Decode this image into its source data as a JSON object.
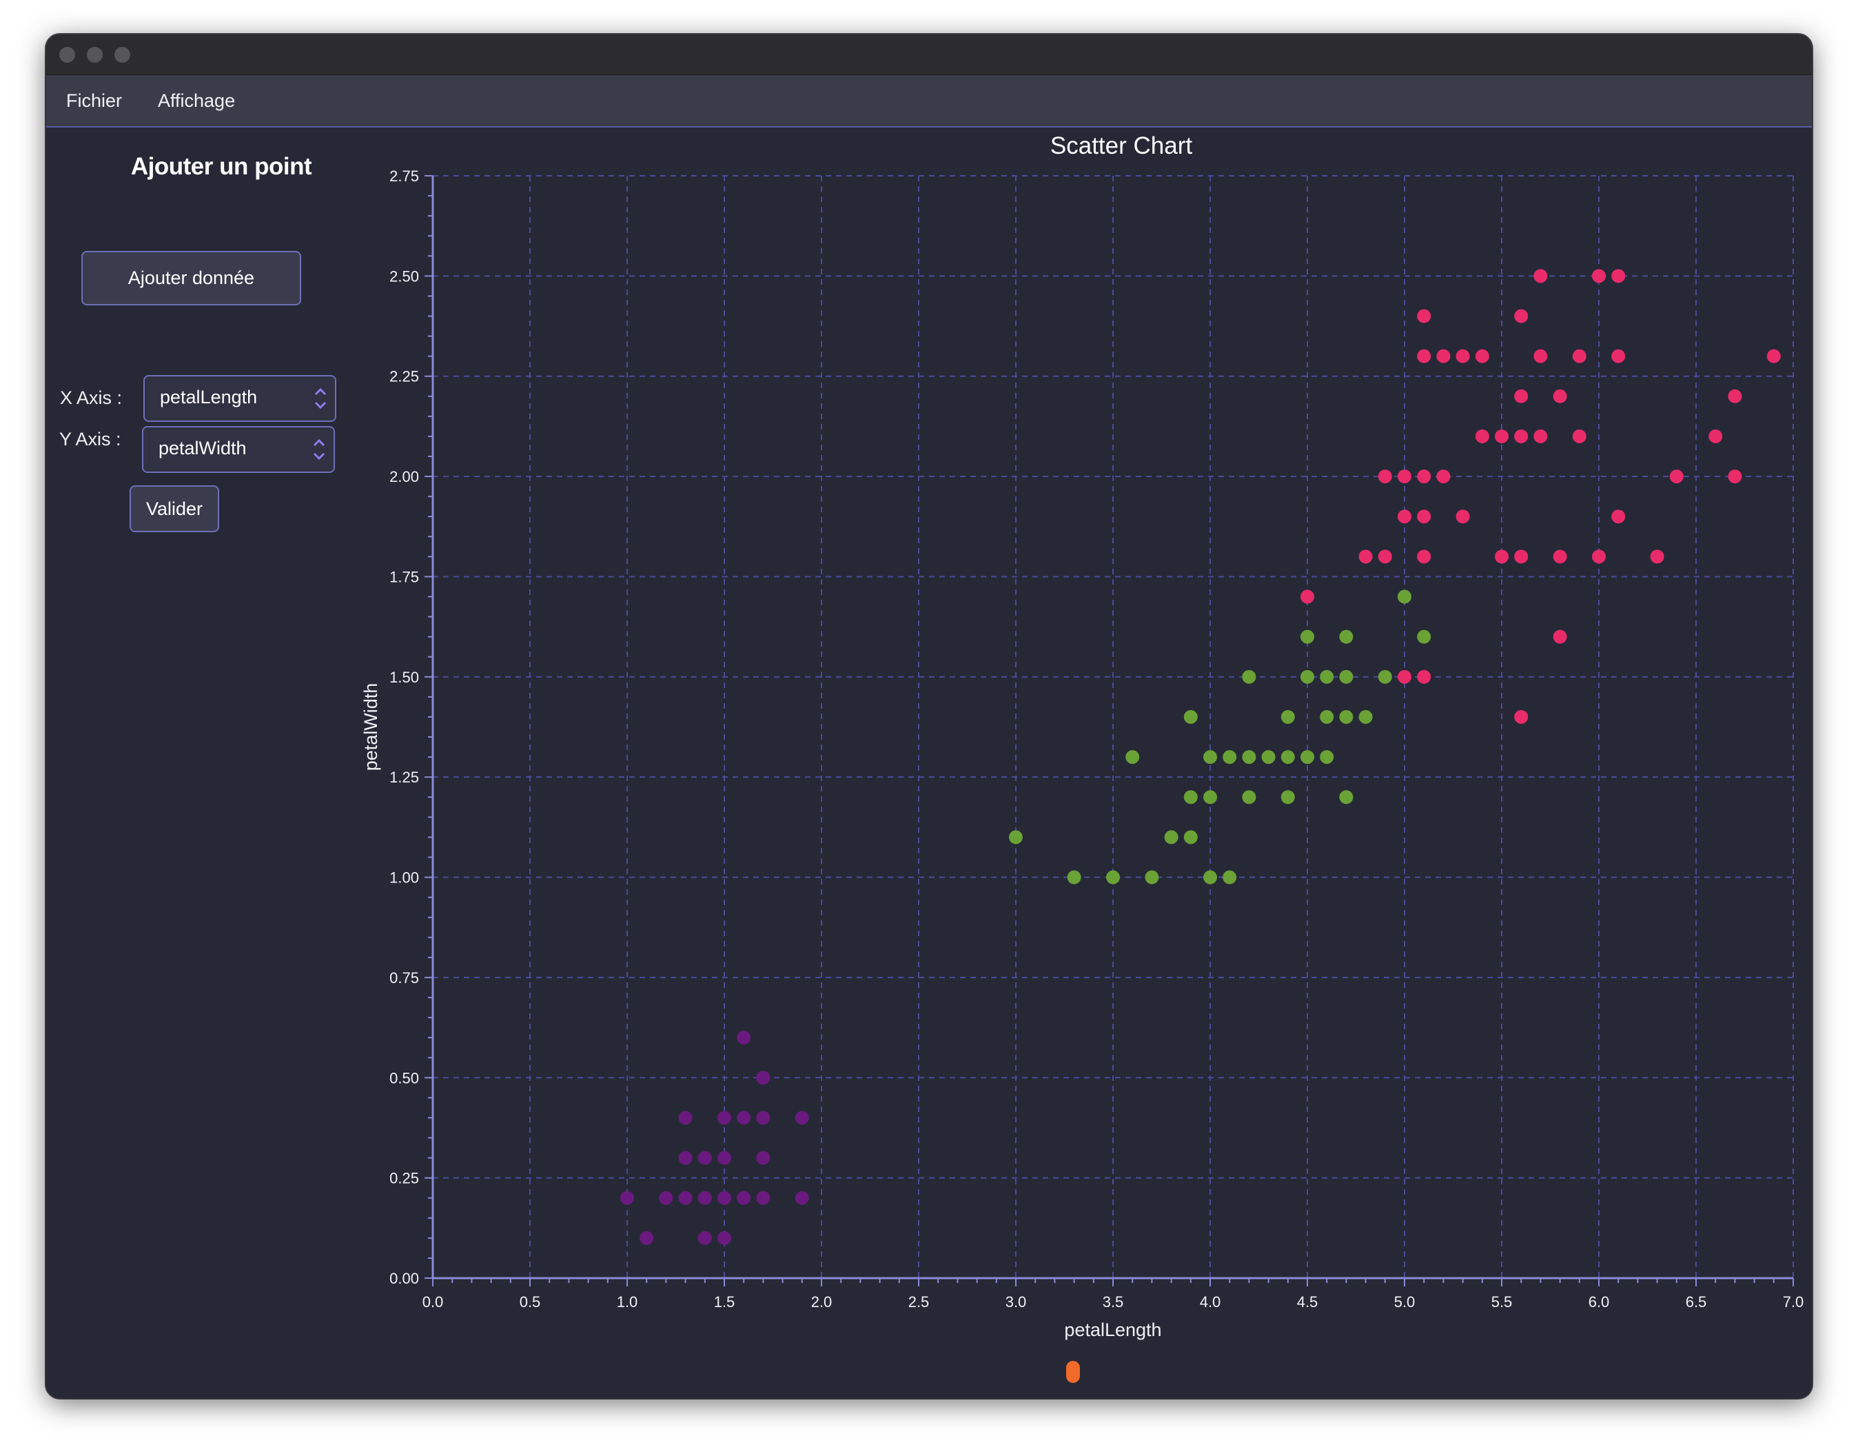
{
  "window": {
    "menu": [
      "Fichier",
      "Affichage"
    ]
  },
  "sidebar": {
    "title": "Ajouter un point",
    "add_button_label": "Ajouter donnée",
    "x_axis_label": "X Axis :",
    "y_axis_label": "Y Axis :",
    "x_axis_value": "petalLength",
    "y_axis_value": "petalWidth",
    "validate_label": "Valider"
  },
  "colors": {
    "setosa": "#6a1a7e",
    "versicolor": "#6aa236",
    "virginica": "#ea2b6a",
    "grid": "#4a4b9a",
    "axis": "#8a8ad8",
    "text": "#f1f1f5"
  },
  "chart_data": {
    "type": "scatter",
    "title": "Scatter Chart",
    "xlabel": "petalLength",
    "ylabel": "petalWidth",
    "xlim": [
      0,
      7
    ],
    "ylim": [
      0,
      2.75
    ],
    "xticks": [
      "0.0",
      "0.5",
      "1.0",
      "1.5",
      "2.0",
      "2.5",
      "3.0",
      "3.5",
      "4.0",
      "4.5",
      "5.0",
      "5.5",
      "6.0",
      "6.5",
      "7.0"
    ],
    "yticks": [
      "0.00",
      "0.25",
      "0.50",
      "0.75",
      "1.00",
      "1.25",
      "1.50",
      "1.75",
      "2.00",
      "2.25",
      "2.50",
      "2.75"
    ],
    "grid": true,
    "series": [
      {
        "color": "#6a1a7e",
        "points": [
          [
            1.0,
            0.2
          ],
          [
            1.1,
            0.1
          ],
          [
            1.2,
            0.2
          ],
          [
            1.3,
            0.2
          ],
          [
            1.3,
            0.3
          ],
          [
            1.3,
            0.4
          ],
          [
            1.4,
            0.1
          ],
          [
            1.4,
            0.2
          ],
          [
            1.4,
            0.3
          ],
          [
            1.5,
            0.1
          ],
          [
            1.5,
            0.2
          ],
          [
            1.5,
            0.3
          ],
          [
            1.5,
            0.4
          ],
          [
            1.6,
            0.2
          ],
          [
            1.6,
            0.4
          ],
          [
            1.6,
            0.6
          ],
          [
            1.7,
            0.2
          ],
          [
            1.7,
            0.3
          ],
          [
            1.7,
            0.4
          ],
          [
            1.7,
            0.5
          ],
          [
            1.9,
            0.2
          ],
          [
            1.9,
            0.4
          ]
        ]
      },
      {
        "color": "#6aa236",
        "points": [
          [
            3.0,
            1.1
          ],
          [
            3.3,
            1.0
          ],
          [
            3.5,
            1.0
          ],
          [
            3.6,
            1.3
          ],
          [
            3.7,
            1.0
          ],
          [
            3.8,
            1.1
          ],
          [
            3.9,
            1.1
          ],
          [
            3.9,
            1.2
          ],
          [
            3.9,
            1.4
          ],
          [
            4.0,
            1.0
          ],
          [
            4.0,
            1.2
          ],
          [
            4.0,
            1.3
          ],
          [
            4.1,
            1.0
          ],
          [
            4.1,
            1.3
          ],
          [
            4.2,
            1.2
          ],
          [
            4.2,
            1.3
          ],
          [
            4.2,
            1.5
          ],
          [
            4.3,
            1.3
          ],
          [
            4.4,
            1.2
          ],
          [
            4.4,
            1.3
          ],
          [
            4.4,
            1.4
          ],
          [
            4.5,
            1.3
          ],
          [
            4.5,
            1.5
          ],
          [
            4.5,
            1.6
          ],
          [
            4.6,
            1.3
          ],
          [
            4.6,
            1.4
          ],
          [
            4.6,
            1.5
          ],
          [
            4.7,
            1.2
          ],
          [
            4.7,
            1.4
          ],
          [
            4.7,
            1.5
          ],
          [
            4.7,
            1.6
          ],
          [
            4.8,
            1.4
          ],
          [
            4.9,
            1.5
          ],
          [
            5.0,
            1.7
          ],
          [
            5.1,
            1.6
          ]
        ]
      },
      {
        "color": "#ea2b6a",
        "points": [
          [
            4.5,
            1.7
          ],
          [
            4.8,
            1.8
          ],
          [
            4.9,
            1.8
          ],
          [
            4.9,
            2.0
          ],
          [
            5.0,
            1.5
          ],
          [
            5.0,
            1.9
          ],
          [
            5.0,
            2.0
          ],
          [
            5.1,
            1.5
          ],
          [
            5.1,
            1.8
          ],
          [
            5.1,
            1.9
          ],
          [
            5.1,
            2.0
          ],
          [
            5.1,
            2.3
          ],
          [
            5.1,
            2.4
          ],
          [
            5.2,
            2.0
          ],
          [
            5.2,
            2.3
          ],
          [
            5.3,
            1.9
          ],
          [
            5.3,
            2.3
          ],
          [
            5.4,
            2.1
          ],
          [
            5.4,
            2.3
          ],
          [
            5.5,
            1.8
          ],
          [
            5.5,
            2.1
          ],
          [
            5.6,
            1.4
          ],
          [
            5.6,
            1.8
          ],
          [
            5.6,
            2.1
          ],
          [
            5.6,
            2.2
          ],
          [
            5.6,
            2.4
          ],
          [
            5.7,
            2.1
          ],
          [
            5.7,
            2.3
          ],
          [
            5.7,
            2.5
          ],
          [
            5.8,
            1.6
          ],
          [
            5.8,
            1.8
          ],
          [
            5.8,
            2.2
          ],
          [
            5.9,
            2.1
          ],
          [
            5.9,
            2.3
          ],
          [
            6.0,
            1.8
          ],
          [
            6.0,
            2.5
          ],
          [
            6.1,
            1.9
          ],
          [
            6.1,
            2.3
          ],
          [
            6.1,
            2.5
          ],
          [
            6.3,
            1.8
          ],
          [
            6.4,
            2.0
          ],
          [
            6.6,
            2.1
          ],
          [
            6.7,
            2.0
          ],
          [
            6.7,
            2.2
          ],
          [
            6.9,
            2.3
          ]
        ]
      }
    ]
  }
}
